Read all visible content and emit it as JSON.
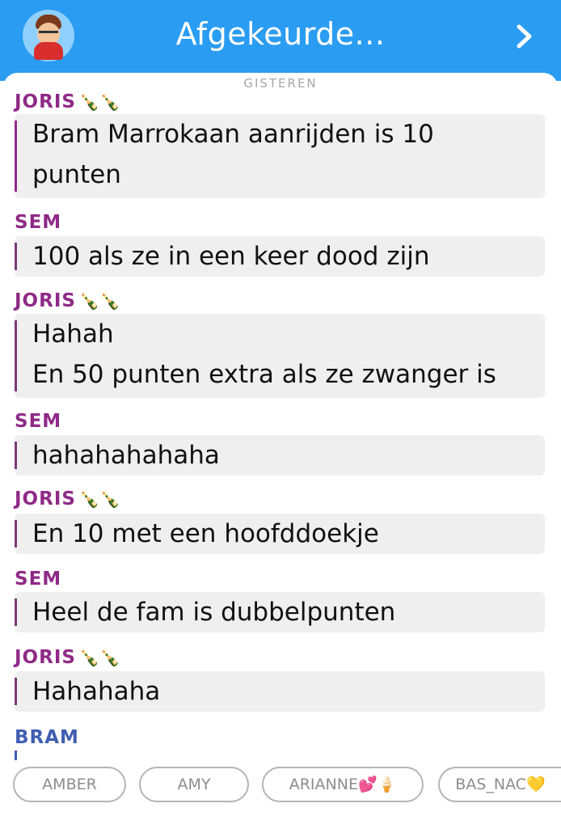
{
  "header": {
    "title": "Afgekeurde...",
    "accent": "#2a9cf2",
    "icons": [
      "bitmoji-avatar",
      "chevron-right-icon"
    ]
  },
  "date_separator": "GISTEREN",
  "messages": [
    {
      "sender": "JORIS",
      "sender_emoji": "🍾🍾",
      "lines": [
        "Bram Marrokaan aanrijden is 10",
        "punten"
      ]
    },
    {
      "sender": "SEM",
      "sender_emoji": "",
      "lines": [
        "100 als ze in een keer dood zijn"
      ]
    },
    {
      "sender": "JORIS",
      "sender_emoji": "🍾🍾",
      "lines": [
        "Hahah",
        "En 50 punten extra als ze zwanger is"
      ]
    },
    {
      "sender": "SEM",
      "sender_emoji": "",
      "lines": [
        "hahahahahaha"
      ]
    },
    {
      "sender": "JORIS",
      "sender_emoji": "🍾🍾",
      "lines": [
        "En 10 met een hoofddoekje"
      ]
    },
    {
      "sender": "SEM",
      "sender_emoji": "",
      "lines": [
        "Heel de fam is dubbelpunten"
      ]
    },
    {
      "sender": "JORIS",
      "sender_emoji": "🍾🍾",
      "lines": [
        "Hahahaha"
      ]
    },
    {
      "sender": "BRAM",
      "sender_emoji": "",
      "lines": []
    }
  ],
  "recipient_chips": [
    {
      "label": "AMBER"
    },
    {
      "label": "AMY"
    },
    {
      "label": "ARIANNE💕🍦"
    },
    {
      "label": "BAS_NAC💛"
    }
  ],
  "colors": {
    "joris": "#8f2a86",
    "sem": "#8f2a86",
    "bram": "#3f5fb1",
    "bubble": "#efefef"
  }
}
